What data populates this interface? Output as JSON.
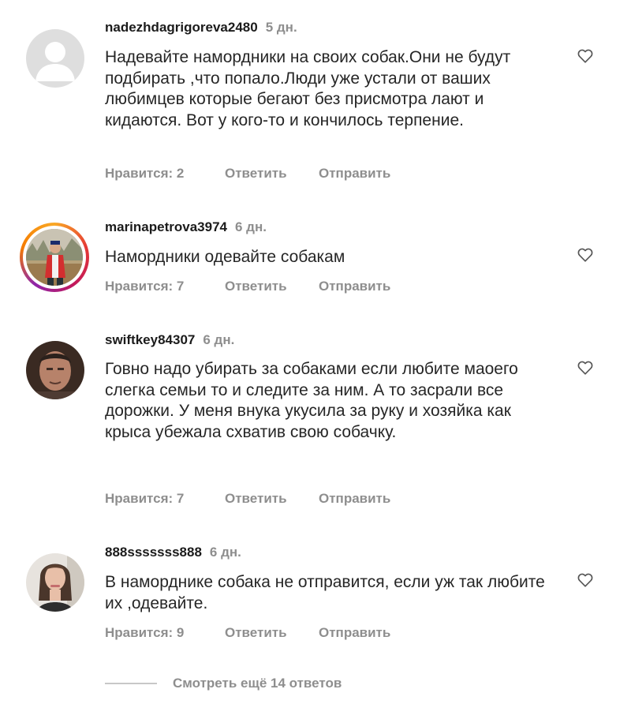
{
  "icons": {
    "like": "heart-outline-icon",
    "avatar_default": "default-user-silhouette-icon"
  },
  "colors": {
    "secondary_text": "#8e8e8e",
    "primary_text": "#262626",
    "story_ring": "#e53935"
  },
  "comments": [
    {
      "username": "nadezhdagrigoreva2480",
      "time": "5 дн.",
      "text": "Надевайте намордники на своих собак.Они не будут подбирать ,что попало.Люди уже устали от ваших любимцев которые бегают без присмотра лают и кидаются. Вот у кого-то и кончилось терпение.",
      "likes": "Нравится: 2",
      "reply": "Ответить",
      "send": "Отправить"
    },
    {
      "username": "marinapetrova3974",
      "time": "6 дн.",
      "text": "Намордники одевайте собакам",
      "likes": "Нравится: 7",
      "reply": "Ответить",
      "send": "Отправить"
    },
    {
      "username": "swiftkey84307",
      "time": "6 дн.",
      "text": "Говно надо убирать за собаками если любите маоего слегка семьи то и следите за ним. А то засрали все дорожки. У меня внука укусила за руку и хозяйка как крыса убежала схватив свою собачку.",
      "likes": "Нравится: 7",
      "reply": "Ответить",
      "send": "Отправить"
    },
    {
      "username": "888sssssss888",
      "time": "6 дн.",
      "text": "В наморднике собака не отправится, если уж так любите их ,одевайте.",
      "likes": "Нравится: 9",
      "reply": "Ответить",
      "send": "Отправить"
    }
  ],
  "view_more": "Смотреть ещё 14 ответов"
}
